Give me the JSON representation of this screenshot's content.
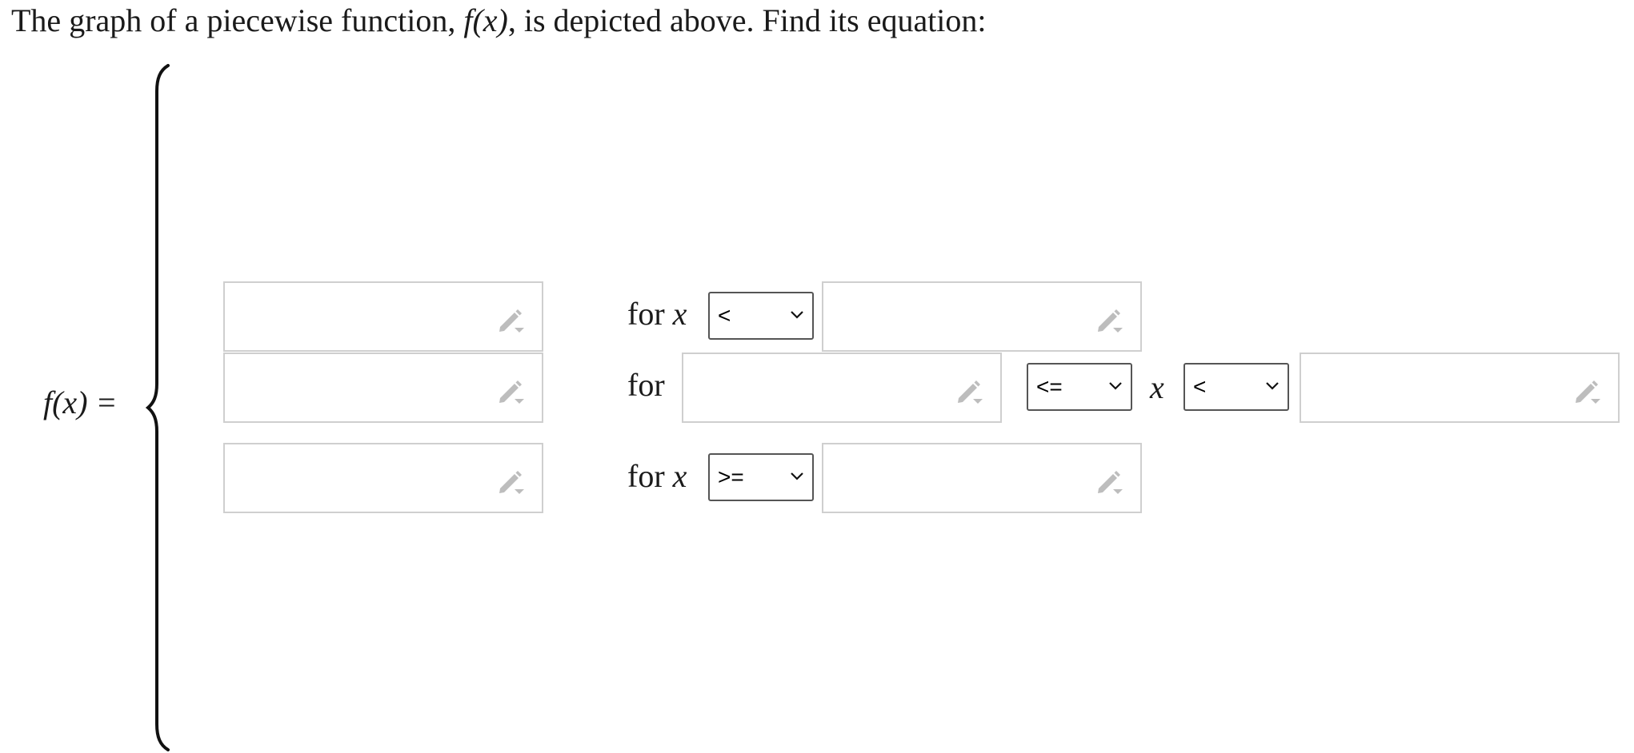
{
  "prompt": {
    "before": "The graph of a piecewise function, ",
    "func": "f(x)",
    "after": ", is depicted above. Find its equation:"
  },
  "equation": {
    "lhs": "f(x) =",
    "variable": "x"
  },
  "rows": [
    {
      "for_label": "for",
      "operator": "<"
    },
    {
      "for_label": "for",
      "lower_operator": "<=",
      "upper_operator": "<"
    },
    {
      "for_label": "for",
      "operator": ">="
    }
  ],
  "icons": {
    "input_edit": "pencil-icon",
    "select_arrow": "chevron-down-icon"
  },
  "colors": {
    "input_border": "#cfcfcf",
    "icon": "#bdbdbd",
    "select_border": "#555555"
  }
}
